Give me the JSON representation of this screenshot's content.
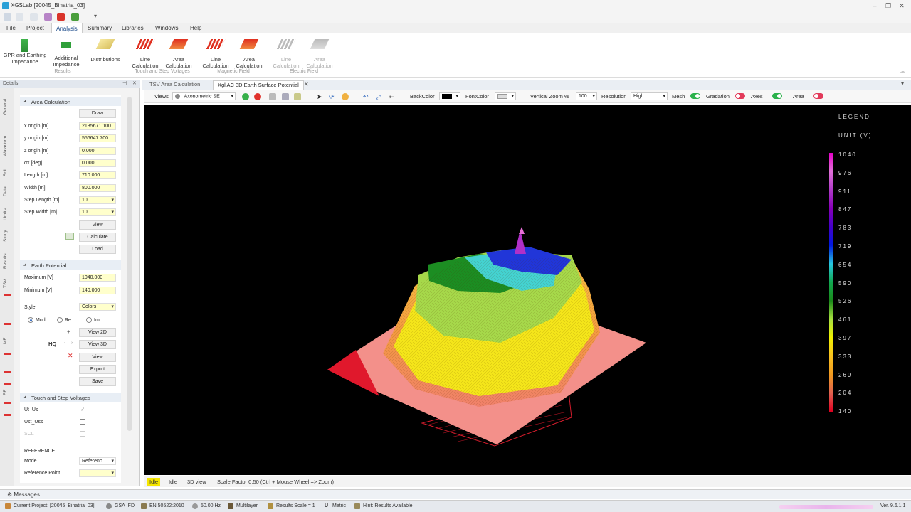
{
  "window": {
    "title": "XGSLab [20045_Binatria_03]",
    "min": "–",
    "restore": "❐",
    "close": "✕"
  },
  "menu": [
    "File",
    "Project",
    "Analysis",
    "Summary",
    "Libraries",
    "Windows",
    "Help"
  ],
  "ribbon": {
    "buttons": [
      {
        "l1": "GPR and Earthing",
        "l2": "Impedance"
      },
      {
        "l1": "Additional",
        "l2": "Impedance"
      },
      {
        "l1": "Distributions",
        "l2": ""
      },
      {
        "l1": "Line",
        "l2": "Calculation"
      },
      {
        "l1": "Area",
        "l2": "Calculation"
      },
      {
        "l1": "Line",
        "l2": "Calculation"
      },
      {
        "l1": "Area",
        "l2": "Calculation"
      },
      {
        "l1": "Line",
        "l2": "Calculation"
      },
      {
        "l1": "Area",
        "l2": "Calculation"
      }
    ],
    "groups": [
      "Results",
      "Touch and Step Voltages",
      "Magnetic Field",
      "Electric Field"
    ]
  },
  "details": {
    "header": "Details",
    "vtabs": [
      "General",
      "Waveform",
      "Soil",
      "Data",
      "Limits",
      "Study",
      "Results",
      "TSV",
      "MF",
      "EF"
    ],
    "area": {
      "title": "Area Calculation",
      "draw": "Draw",
      "fields": [
        {
          "label": "x origin [m]",
          "value": "2135671.100"
        },
        {
          "label": "y origin [m]",
          "value": "556647.700"
        },
        {
          "label": "z origin [m]",
          "value": "0.000"
        },
        {
          "label": "αx [deg]",
          "value": "0.000"
        },
        {
          "label": "Length [m]",
          "value": "710.000"
        },
        {
          "label": "Width [m]",
          "value": "800.000"
        },
        {
          "label": "Step Length [m]",
          "value": "10"
        },
        {
          "label": "Step Width [m]",
          "value": "10"
        }
      ],
      "view": "View",
      "calculate": "Calculate",
      "load": "Load"
    },
    "earth": {
      "title": "Earth Potential",
      "max_label": "Maximum [V]",
      "max": "1040.000",
      "min_label": "Minimum [V]",
      "min": "140.000",
      "style_label": "Style",
      "style": "Colors",
      "radios": [
        "Mod",
        "Re",
        "Im"
      ],
      "plus": "+",
      "view2d": "View 2D",
      "hq": "HQ",
      "view3d": "View 3D",
      "view": "View",
      "export": "Export",
      "save": "Save"
    },
    "tsv": {
      "title": "Touch and Step Voltages",
      "ut": "Ut_Us",
      "ust": "Ust_Uss",
      "scl": "SCL",
      "reference": "REFERENCE",
      "mode_label": "Mode",
      "mode": "Referenc...",
      "refpoint_label": "Reference Point"
    }
  },
  "doc_tabs": [
    "TSV Area Calculation",
    "Xgl AC 3D Earth Surface Potential"
  ],
  "toolbar": {
    "views": "Views",
    "view_value": "Axonometric SE",
    "backcolor": "BackColor",
    "fontcolor": "FontColor",
    "vzoom": "Vertical Zoom %",
    "vzoom_value": "100",
    "resolution": "Resolution",
    "resolution_value": "High",
    "mesh": "Mesh",
    "gradation": "Gradation",
    "axes": "Axes",
    "area": "Area"
  },
  "legend": {
    "title": "LEGEND",
    "unit": "UNIT (V)",
    "ticks": [
      "1040",
      "976",
      "911",
      "847",
      "783",
      "719",
      "654",
      "590",
      "526",
      "461",
      "397",
      "333",
      "269",
      "204",
      "140"
    ],
    "colors": [
      "#e600c8",
      "#e070d8",
      "#b03ac8",
      "#8800b8",
      "#4400c8",
      "#0018e0",
      "#28c8e0",
      "#12a850",
      "#1a8a1a",
      "#a8e040",
      "#f0f000",
      "#f8c020",
      "#f09a20",
      "#e06050",
      "#e00020"
    ]
  },
  "view_status": {
    "badge": "Idle",
    "idle": "Idle",
    "mode": "3D view",
    "scale": "Scale Factor 0.50 (Ctrl + Mouse Wheel => Zoom)"
  },
  "messages": "Messages",
  "status": {
    "project": "Current Project: [20045_Binatria_03]",
    "module": "GSA_FD",
    "standard": "EN 50522:2010",
    "freq": "50.00 Hz",
    "layer": "Multilayer",
    "scale": "Results Scale = 1",
    "units": "Metric",
    "hint": "Hint: Results Available",
    "version": "Ver. 9.6.1.1"
  }
}
